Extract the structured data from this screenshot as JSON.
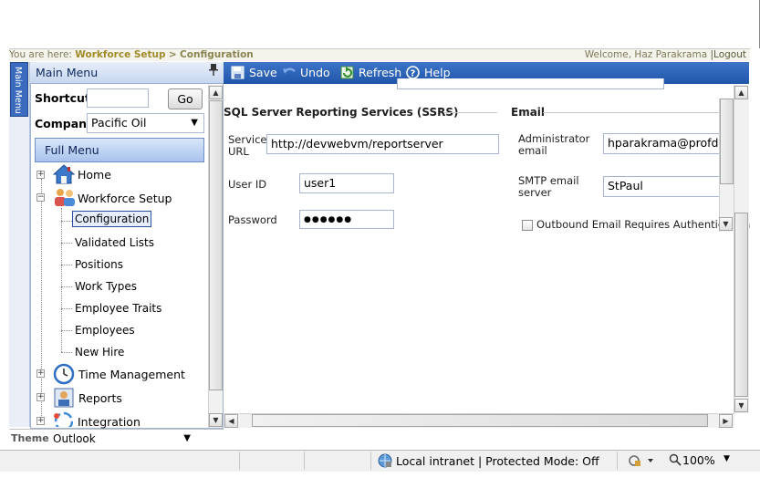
{
  "breadcrumb": {
    "prefix": "You are here:",
    "link": "Workforce Setup",
    "separator": ">",
    "current": "Configuration",
    "welcome": "Welcome, Haz Parakrama",
    "logout": "|Logout"
  },
  "side_tab": {
    "label": "Main Menu"
  },
  "main_menu": {
    "title": "Main Menu",
    "shortcut_label": "Shortcut",
    "shortcut_value": "",
    "go_label": "Go",
    "company_label": "Company",
    "company_value": "Pacific Oil",
    "full_menu_label": "Full Menu",
    "tree": {
      "home": "Home",
      "workforce_setup": "Workforce Setup",
      "children": [
        "Configuration",
        "Validated Lists",
        "Positions",
        "Work Types",
        "Employee Traits",
        "Employees",
        "New Hire"
      ],
      "time_management": "Time Management",
      "reports": "Reports",
      "integration": "Integration"
    },
    "theme_label": "Theme",
    "theme_value": "Outlook"
  },
  "toolbar": {
    "save": "Save",
    "undo": "Undo",
    "refresh": "Refresh",
    "help": "Help"
  },
  "ssrs": {
    "title": "SQL Server Reporting Services (SSRS)",
    "service_url_label": "Service URL",
    "service_url_value": "http://devwebvm/reportserver",
    "user_id_label": "User ID",
    "user_id_value": "user1",
    "password_label": "Password",
    "password_value": "●●●●●●"
  },
  "email": {
    "title": "Email",
    "admin_label": "Administrator email",
    "admin_value": "hparakrama@profdata.",
    "smtp_label": "SMTP email server",
    "smtp_value": "StPaul",
    "auth_label": "Outbound Email Requires Authentication"
  },
  "statusbar": {
    "zone": "Local intranet | Protected Mode: Off",
    "zoom": "100%"
  },
  "colors": {
    "toolbar": "#2a63b9",
    "accent": "#3b6bbf",
    "breadcrumb_link": "#a08a2a"
  }
}
